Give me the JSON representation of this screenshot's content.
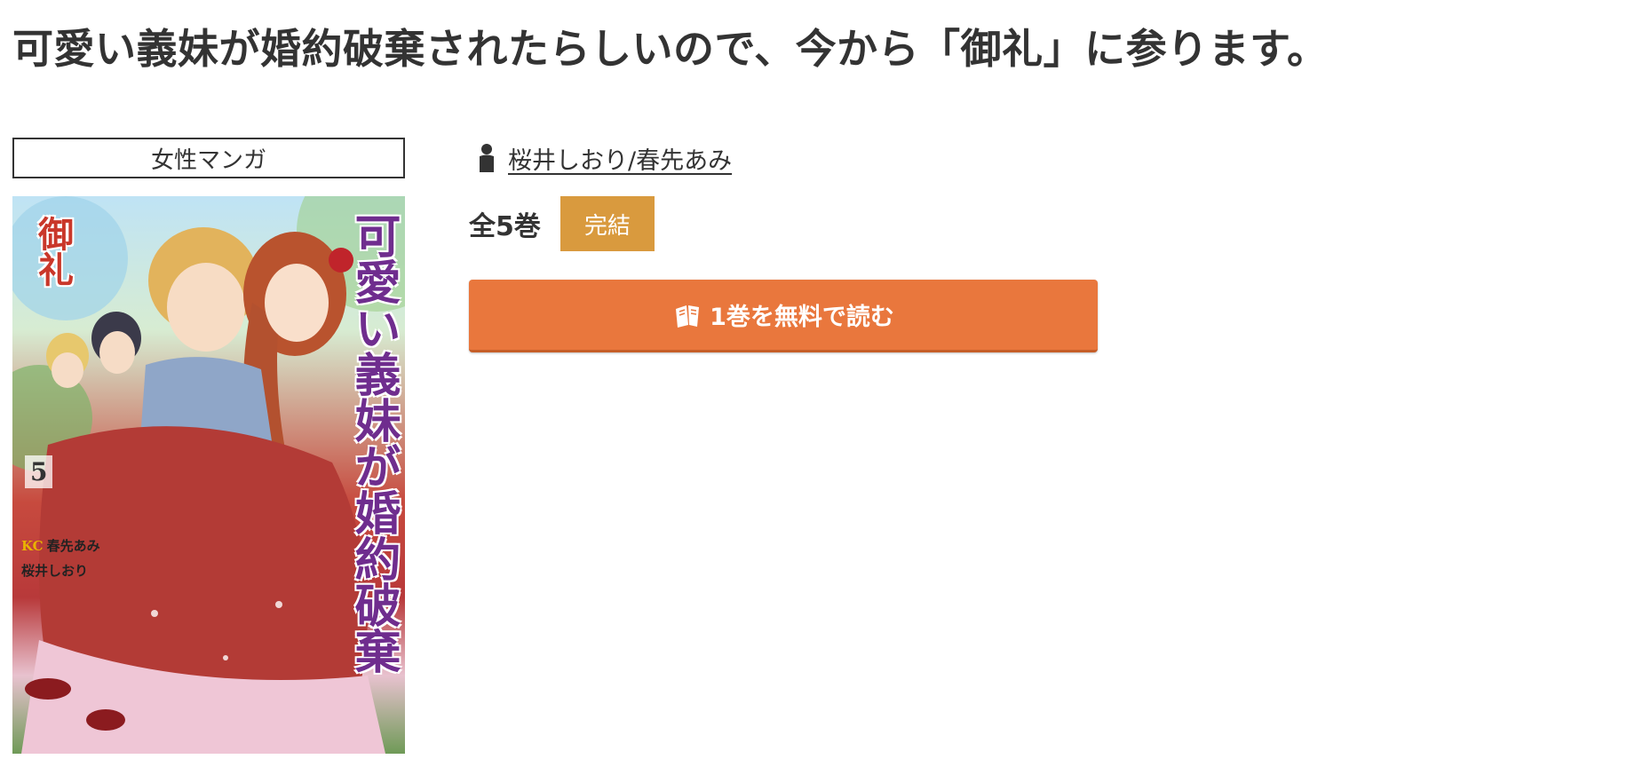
{
  "title": "可愛い義妹が婚約破棄されたらしいので、今から「御礼」に参ります。",
  "genre": "女性マンガ",
  "author": {
    "icon": "person-icon",
    "names": "桜井しおり/春先あみ"
  },
  "volumes": {
    "count_label": "全5巻",
    "status": "完結",
    "status_color": "#d99a3e"
  },
  "read_button": {
    "icon": "book-icon",
    "label": "1巻を無料で読む",
    "color": "#e9773d"
  },
  "cover": {
    "title_text": "可愛い義妹が婚約破棄",
    "sub_text": "御礼",
    "volume_number": "5",
    "authors": [
      "春先あみ",
      "桜井しおり"
    ]
  }
}
